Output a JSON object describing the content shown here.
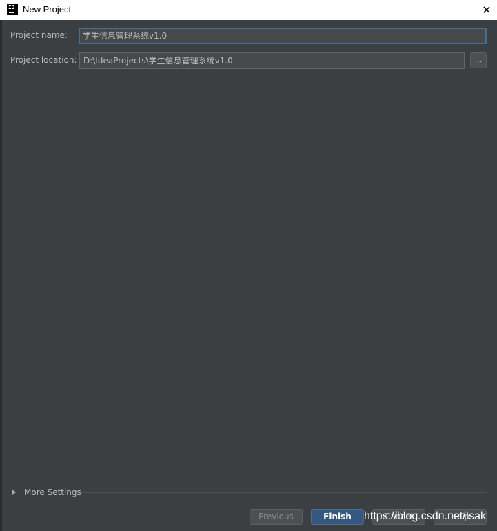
{
  "window": {
    "title": "New Project",
    "app_icon_text": "IJ",
    "close_glyph": "✕"
  },
  "form": {
    "project_name_label": "Project name:",
    "project_name_value": "学生信息管理系统v1.0",
    "project_location_label": "Project location:",
    "project_location_value": "D:\\IdeaProjects\\学生信息管理系统v1.0",
    "browse_label": "..."
  },
  "more_settings": {
    "label": "More Settings"
  },
  "buttons": {
    "previous": "Previous",
    "finish": "Finish",
    "cancel": "Cancel",
    "help": "Help"
  },
  "watermark": "https://blog.csdn.net/Isak_",
  "colors": {
    "background": "#3c3f41",
    "field_background": "#45494a",
    "focus_border": "#466d94",
    "primary_button": "#365880",
    "text": "#bbbbbb"
  }
}
